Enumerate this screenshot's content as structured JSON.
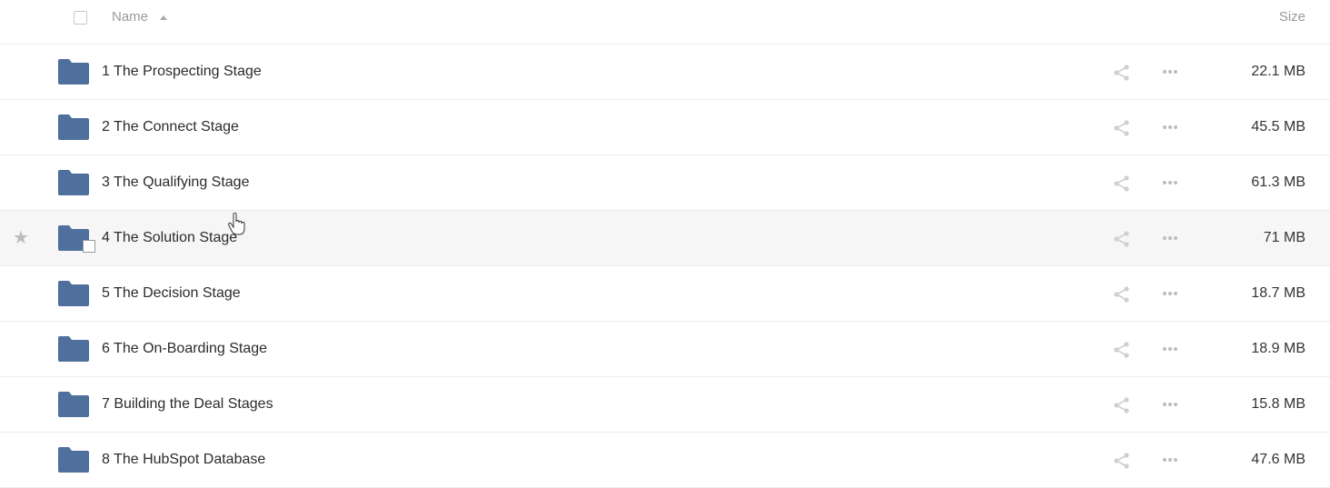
{
  "header": {
    "name_label": "Name",
    "size_label": "Size",
    "sort_direction": "ascending"
  },
  "colors": {
    "folder": "#4f6f9c",
    "hover_row": "#f6f6f6",
    "divider": "#ececec",
    "muted_text": "#9a9a9a"
  },
  "files": [
    {
      "name": "1 The Prospecting Stage",
      "size": "22.1 MB",
      "icon": "folder-icon"
    },
    {
      "name": "2 The Connect Stage",
      "size": "45.5 MB",
      "icon": "folder-icon"
    },
    {
      "name": "3 The Qualifying Stage",
      "size": "61.3 MB",
      "icon": "folder-icon"
    },
    {
      "name": "4 The Solution Stage",
      "size": "71 MB",
      "icon": "folder-icon",
      "hovered": true
    },
    {
      "name": "5 The Decision Stage",
      "size": "18.7 MB",
      "icon": "folder-icon"
    },
    {
      "name": "6 The On-Boarding Stage",
      "size": "18.9 MB",
      "icon": "folder-icon"
    },
    {
      "name": "7 Building the Deal Stages",
      "size": "15.8 MB",
      "icon": "folder-icon"
    },
    {
      "name": "8 The HubSpot Database",
      "size": "47.6 MB",
      "icon": "folder-icon"
    }
  ],
  "row_icons": {
    "share": "share-icon",
    "more": "more-options-icon",
    "favorite": "star-icon"
  }
}
